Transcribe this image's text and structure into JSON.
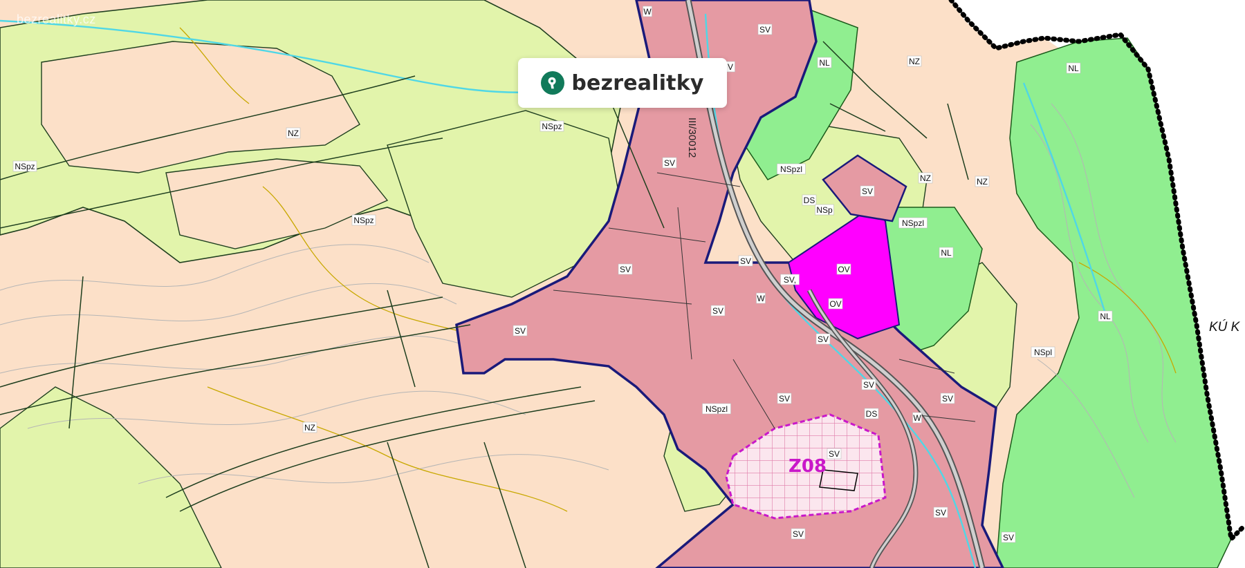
{
  "app": {
    "watermark": "bezrealitky.cz",
    "brand_name": "bezrealitky",
    "brand_icon": "map-pin-key-icon",
    "brand_color": "#117a5a"
  },
  "map": {
    "colors": {
      "background": "#fce0c8",
      "meadow_light": "#e2f4ab",
      "forest_green": "#90ee90",
      "settlement": "#e59aa3",
      "civic": "#ff00ff",
      "boundary": "#000000",
      "contour": "#b5b5b5",
      "contour_accent": "#c8a800",
      "water": "#4fd7e6",
      "settlement_outline": "#1a1a7a",
      "development_area": "#c918c9"
    },
    "labels": {
      "w_top": "W",
      "sv_top": "SV",
      "v_top": "V",
      "nl_top": "NL",
      "nz_top": "NZ",
      "nl_right_top": "NL",
      "nspz_center": "NSpz",
      "nz_left": "NZ",
      "nspz_left": "NSpz",
      "sv_road": "SV",
      "nspzl_mid": "NSpzl",
      "sv_plot": "SV",
      "nz_right": "NZ",
      "nz_far_right": "NZ",
      "ds_mid": "DS",
      "nsp_mid": "NSp",
      "nspzl_right": "NSpzl",
      "nspz_mid": "NSpz",
      "nl_mid": "NL",
      "sv_center": "SV",
      "sv_near_ov": "SV",
      "ov_1": "OV",
      "sv_small": "SV,",
      "w_mid": "W",
      "ov_2": "OV",
      "sv_mid2": "SV",
      "nl_right": "NL",
      "sv_left": "SV",
      "sv_creek": "SV",
      "nspl": "NSpl",
      "sv_lower": "SV",
      "sv_lower2": "SV",
      "sv_lower3": "SV",
      "ds_lower": "DS",
      "w_lower": "W",
      "nspzl_lower": "NSpzl",
      "nz_bottom": "NZ",
      "sv_z08": "SV",
      "sv_bottom_right": "SV",
      "sv_bottom": "SV",
      "sv_corner": "SV"
    },
    "road_code": "III/30012",
    "zone_code": "Z08",
    "cadastral_label": "KÚ K"
  }
}
